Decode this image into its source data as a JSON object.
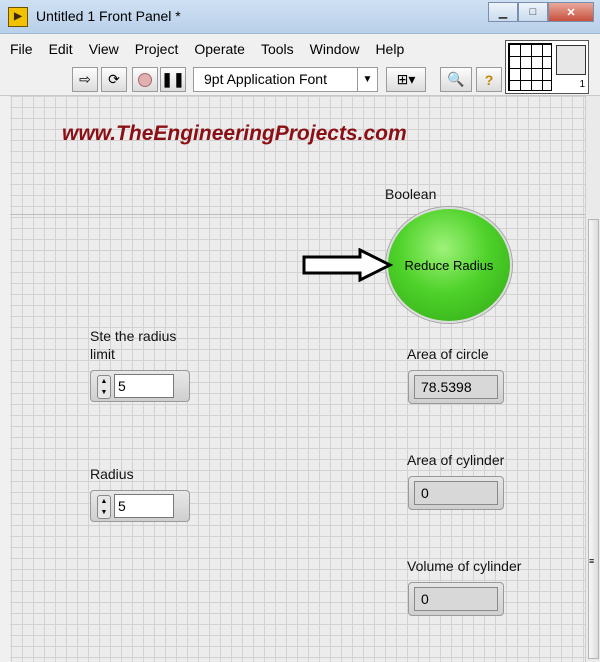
{
  "window": {
    "title": "Untitled 1 Front Panel *",
    "app_icon": "labview-vi-icon"
  },
  "menu": [
    "File",
    "Edit",
    "View",
    "Project",
    "Operate",
    "Tools",
    "Window",
    "Help"
  ],
  "toolbar": {
    "font": "9pt Application Font",
    "icons": [
      "run-arrow-icon",
      "run-continuously-icon",
      "abort-icon",
      "pause-icon",
      "align-icon",
      "search-icon",
      "help-icon"
    ]
  },
  "connector": {
    "badge": "1"
  },
  "panel": {
    "watermark": "www.TheEngineeringProjects.com",
    "boolean": {
      "label": "Boolean",
      "text": "Reduce Radius"
    },
    "controls": [
      {
        "label": "Ste the radius limit",
        "value": "5"
      },
      {
        "label": "Radius",
        "value": "5"
      }
    ],
    "indicators": [
      {
        "label": "Area of circle",
        "value": "78.5398"
      },
      {
        "label": "Area of cylinder",
        "value": "0"
      },
      {
        "label": "Volume of cylinder",
        "value": "0"
      }
    ]
  },
  "colors": {
    "boolean_on": "#4fd22a",
    "watermark": "#8b0f14"
  }
}
